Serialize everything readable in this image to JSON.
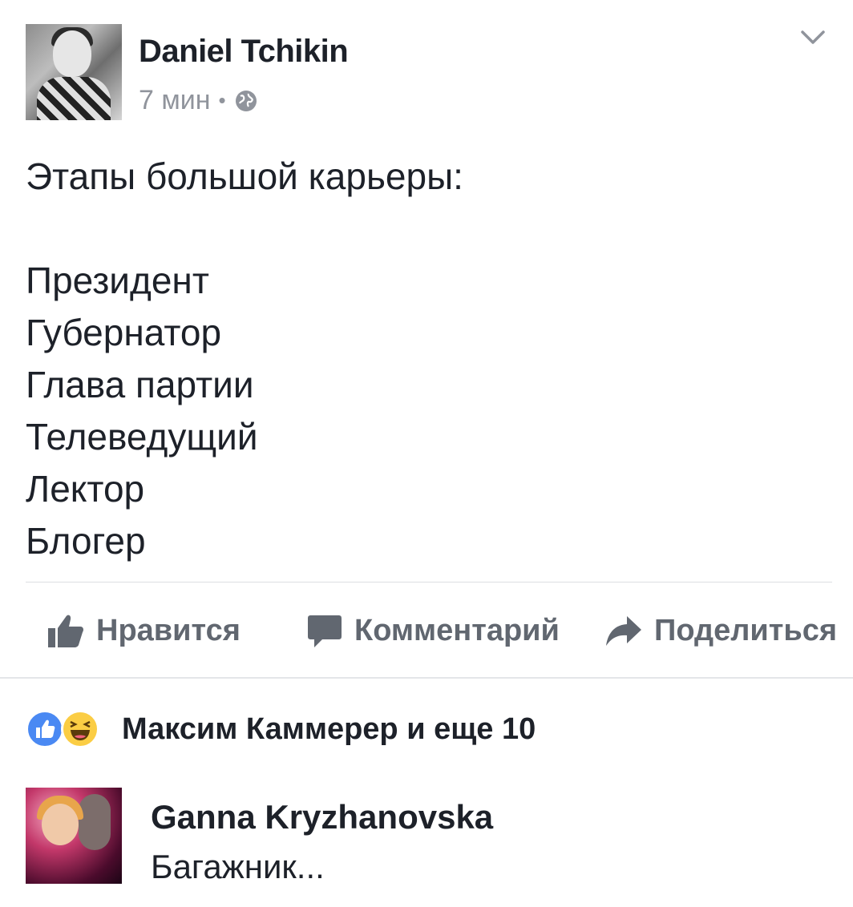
{
  "post": {
    "author": "Daniel Tchikin",
    "time": "7 мин",
    "separator": "•",
    "privacy_icon": "globe-icon",
    "menu_icon": "chevron-down-icon",
    "text_lines": [
      "Этапы большой карьеры:",
      "",
      "Президент",
      "Губернатор",
      "Глава партии",
      "Телеведущий",
      "Лектор",
      "Блогер"
    ]
  },
  "actions": {
    "like_label": "Нравится",
    "comment_label": "Комментарий",
    "share_label": "Поделиться"
  },
  "reactions": {
    "icons": [
      "like-badge-icon",
      "haha-badge-icon"
    ],
    "summary": "Максим Каммерер и еще 10"
  },
  "comment": {
    "author": "Ganna Kryzhanovska",
    "text": "Багажник..."
  },
  "colors": {
    "text": "#1d2129",
    "meta": "#90949c",
    "action": "#616770",
    "like_badge": "#4a89f3",
    "haha_badge": "#fbcd44"
  }
}
